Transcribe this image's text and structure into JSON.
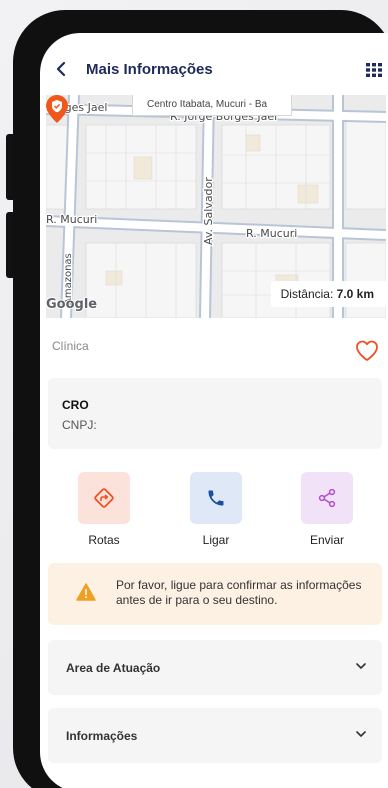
{
  "header": {
    "title": "Mais Informações",
    "back_icon": "chevron-left-icon",
    "menu_icon": "grid-icon"
  },
  "map": {
    "search_text": "Centro Itabata, Mucuri - Ba",
    "street_labels": [
      "Borges Jael",
      "R. Jorge Borges Jael",
      "R. Mucuri",
      "R. Mucuri",
      "Av. Salvador",
      "Amazonas"
    ],
    "attribution": "Google",
    "distance_label": "Distância:",
    "distance_value": "7.0 km",
    "pin_color": "#f0571d"
  },
  "category": "Clínica",
  "favorite_icon": "heart-outline-icon",
  "info_card": {
    "cro_label": "CRO",
    "cnpj_label": "CNPJ:"
  },
  "actions": [
    {
      "label": "Rotas",
      "icon": "directions-icon",
      "color": "#ef4f22"
    },
    {
      "label": "Ligar",
      "icon": "phone-icon",
      "color": "#1c4ea3"
    },
    {
      "label": "Enviar",
      "icon": "share-icon",
      "color": "#b44ccd"
    }
  ],
  "warning": {
    "icon": "warning-icon",
    "text": "Por favor, ligue para confirmar as informações antes de ir para o seu destino."
  },
  "accordions": [
    {
      "label": "Area de Atuação"
    },
    {
      "label": "Informações"
    }
  ]
}
